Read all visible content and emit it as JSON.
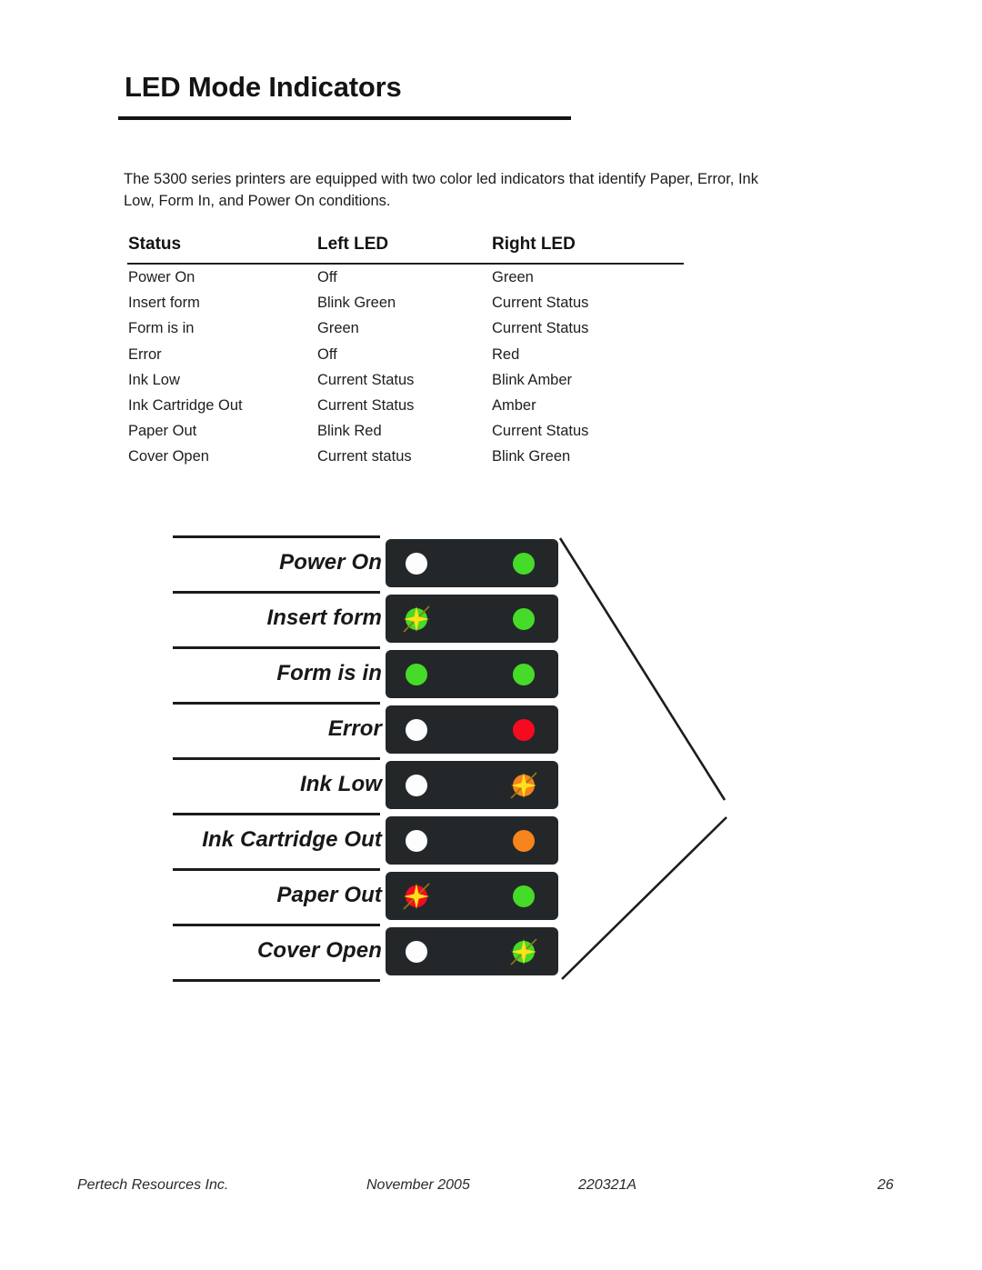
{
  "document": {
    "title": "LED Mode Indicators",
    "intro": "The 5300 series printers are equipped with two color led indicators that identify Paper, Error, Ink Low, Form In, and Power On conditions."
  },
  "table": {
    "headers": [
      "Status",
      "Left LED",
      "Right LED"
    ],
    "rows": [
      {
        "status": "Power On",
        "left": "Off",
        "right": "Green"
      },
      {
        "status": "Insert form",
        "left": "Blink Green",
        "right": "Current Status"
      },
      {
        "status": "Form is in",
        "left": "Green",
        "right": "Current Status"
      },
      {
        "status": "Error",
        "left": "Off",
        "right": "Red"
      },
      {
        "status": "Ink Low",
        "left": "Current Status",
        "right": "Blink Amber"
      },
      {
        "status": "Ink Cartridge Out",
        "left": "Current Status",
        "right": "Amber"
      },
      {
        "status": "Paper Out",
        "left": "Blink Red",
        "right": "Current Status"
      },
      {
        "status": "Cover Open",
        "left": "Current status",
        "right": "Blink Green"
      }
    ]
  },
  "diagram": {
    "rows": [
      {
        "label": "Power On",
        "left_led": {
          "color": "off",
          "blink": false
        },
        "right_led": {
          "color": "green",
          "blink": false
        }
      },
      {
        "label": "Insert form",
        "left_led": {
          "color": "green",
          "blink": true
        },
        "right_led": {
          "color": "green",
          "blink": false
        }
      },
      {
        "label": "Form is in",
        "left_led": {
          "color": "green",
          "blink": false
        },
        "right_led": {
          "color": "green",
          "blink": false
        }
      },
      {
        "label": "Error",
        "left_led": {
          "color": "off",
          "blink": false
        },
        "right_led": {
          "color": "red",
          "blink": false
        }
      },
      {
        "label": "Ink Low",
        "left_led": {
          "color": "off",
          "blink": false
        },
        "right_led": {
          "color": "amber",
          "blink": true
        }
      },
      {
        "label": "Ink Cartridge Out",
        "left_led": {
          "color": "off",
          "blink": false
        },
        "right_led": {
          "color": "amber",
          "blink": false
        }
      },
      {
        "label": "Paper Out",
        "left_led": {
          "color": "red",
          "blink": true
        },
        "right_led": {
          "color": "green",
          "blink": false
        }
      },
      {
        "label": "Cover Open",
        "left_led": {
          "color": "off",
          "blink": false
        },
        "right_led": {
          "color": "green",
          "blink": true
        }
      }
    ]
  },
  "colors": {
    "led_off": "#fdfdfd",
    "led_green": "#45db28",
    "led_red": "#f60a20",
    "led_amber": "#f7841c",
    "panel_background": "#242729",
    "blink_star": "#ffe11a",
    "rule": "#191b1d"
  },
  "footer": {
    "company": "Pertech Resources Inc.",
    "date": "November  2005",
    "doc_number": "220321A",
    "page_number": "26"
  }
}
